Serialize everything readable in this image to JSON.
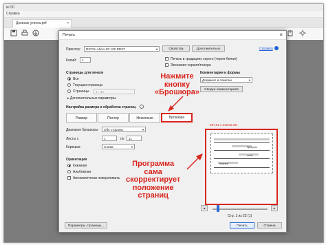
{
  "app": {
    "title": "ie DC",
    "menu": "Справка",
    "tab_label": "Дневник успеха.pdf",
    "tab_close": "×"
  },
  "dialog": {
    "title": "Печать",
    "close": "×",
    "printer_label": "Принтер:",
    "printer_value": "RICOH Aficio SP 100 DDST",
    "properties_button": "Свойства",
    "advanced_button": "Дополнительно",
    "help_link": "Справка",
    "copies_label": "Копий:",
    "copies_value": "1",
    "grayscale_label": "Печать в градациях серого (черно-белая)",
    "save_ink_label": "Экономия чернил/тонера",
    "pages_section": "Страницы для печати",
    "radio_all": "Все",
    "radio_current": "Текущая страница",
    "radio_pages": "Страницы",
    "pages_range_value": "1 - 44",
    "more_options": "Дополнительные параметры",
    "sizing_section": "Настройка размера и обработка страниц",
    "seg_size": "Размер",
    "seg_poster": "Постер",
    "seg_multiple": "Несколько",
    "seg_booklet": "Брошюра",
    "booklet_range_label": "Диапазон брошюры:",
    "booklet_range_value": "Обе стороны",
    "sheets_label": "Листы с",
    "sheets_from": "1",
    "sheets_to_label": "по",
    "sheets_to": "11",
    "binding_label": "Корешок:",
    "binding_value": "Слева",
    "orientation_section": "Ориентация",
    "radio_portrait": "Книжная",
    "radio_landscape": "Альбомная",
    "auto_rotate_label": "Автоматически поворачивать",
    "comments_section": "Комментарии и формы",
    "comments_value": "Документ и пометки",
    "summarize_button": "Сводка комментариев",
    "preview_size": "297,01 x 210,02 мм",
    "page_indicator": "Стр. 1 из 22 (1)",
    "page_setup_button": "Параметры страницы...",
    "print_button": "Печать",
    "cancel_button": "Отмена"
  },
  "annotations": {
    "callout_booklet": [
      "Нажмите",
      "кнопку",
      "«Брошюра»"
    ],
    "callout_program": [
      "Программа",
      "сама",
      "скорректирует",
      "положение",
      "страниц"
    ]
  },
  "preview_snippets": [
    "Прогресс",
    "отчёт",
    "проекта"
  ],
  "colors": {
    "accent": "#d9241c",
    "primary": "#2a6bd8"
  }
}
